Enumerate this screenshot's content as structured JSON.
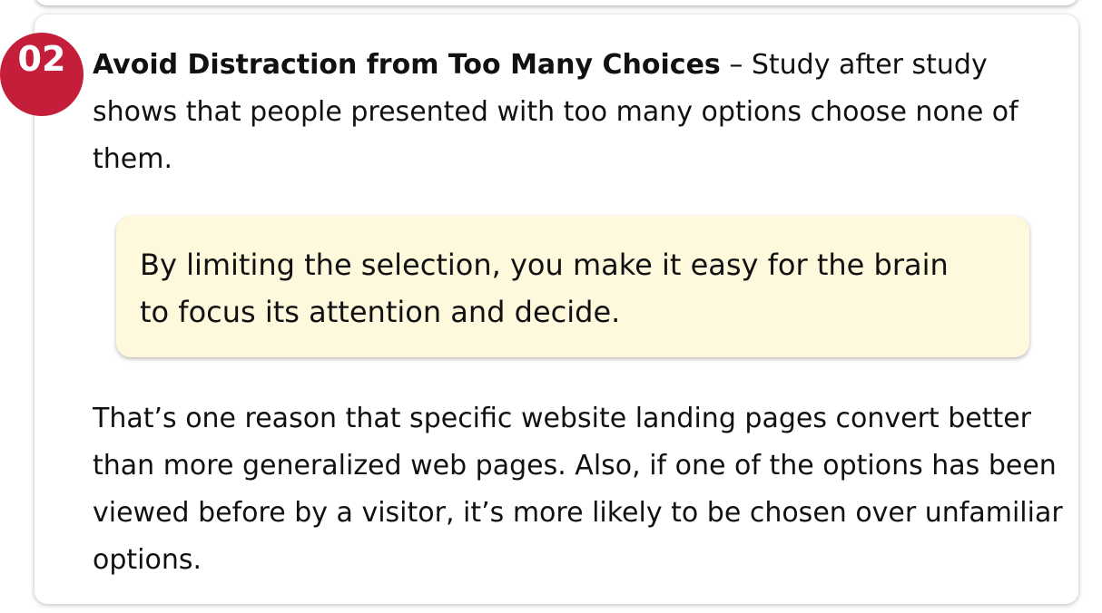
{
  "item": {
    "number": "02",
    "heading": "Avoid Distraction from Too Many Choices",
    "dash": " – ",
    "intro": "Study after study shows that people presented with too many options choose none of them.",
    "callout": "By limiting the selection, you make it easy for the brain to focus its attention and decide.",
    "body": "That’s one reason that specific website landing pages convert better than more generalized web pages. Also, if one of the options has been viewed before by a visitor, it’s more likely to be chosen over unfamiliar options."
  },
  "colors": {
    "badge": "#c41e3a",
    "callout_background": "#fef8dc",
    "text": "#111111"
  }
}
